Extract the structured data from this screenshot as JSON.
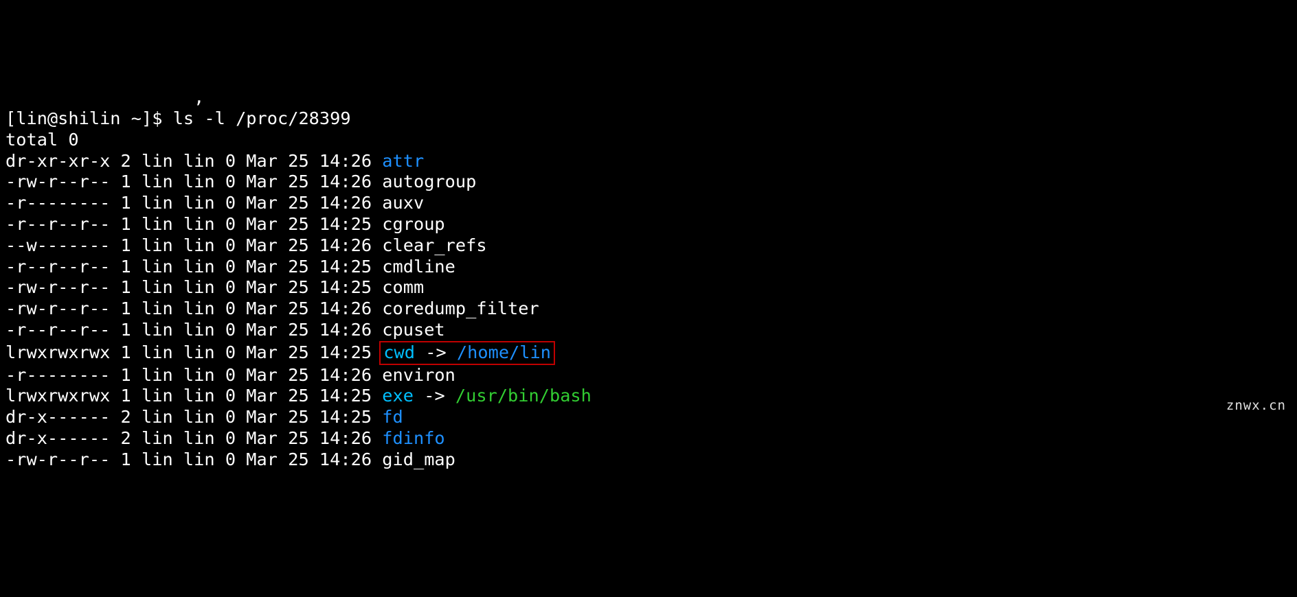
{
  "topfrag": {
    "tail": "                  ,"
  },
  "prompt": {
    "left": "[lin@shilin ~]$ ",
    "cmd": "ls -l /proc/28399"
  },
  "total": "total 0",
  "rows": [
    {
      "perm": "dr-xr-xr-x 2 lin lin 0 Mar 25 14:26 ",
      "name": "attr",
      "nameClass": "blue"
    },
    {
      "perm": "-rw-r--r-- 1 lin lin 0 Mar 25 14:26 ",
      "name": "autogroup",
      "nameClass": "white"
    },
    {
      "perm": "-r-------- 1 lin lin 0 Mar 25 14:26 ",
      "name": "auxv",
      "nameClass": "white"
    },
    {
      "perm": "-r--r--r-- 1 lin lin 0 Mar 25 14:25 ",
      "name": "cgroup",
      "nameClass": "white"
    },
    {
      "perm": "--w------- 1 lin lin 0 Mar 25 14:26 ",
      "name": "clear_refs",
      "nameClass": "white"
    },
    {
      "perm": "-r--r--r-- 1 lin lin 0 Mar 25 14:25 ",
      "name": "cmdline",
      "nameClass": "white"
    },
    {
      "perm": "-rw-r--r-- 1 lin lin 0 Mar 25 14:25 ",
      "name": "comm",
      "nameClass": "white"
    },
    {
      "perm": "-rw-r--r-- 1 lin lin 0 Mar 25 14:26 ",
      "name": "coredump_filter",
      "nameClass": "white"
    },
    {
      "perm": "-r--r--r-- 1 lin lin 0 Mar 25 14:26 ",
      "name": "cpuset",
      "nameClass": "white"
    },
    {
      "perm": "lrwxrwxrwx 1 lin lin 0 Mar 25 14:25 ",
      "name": "cwd",
      "nameClass": "cyan",
      "arrow": " -> ",
      "tgt": "/home/lin",
      "tgtClass": "blue",
      "boxed": true
    },
    {
      "perm": "-r-------- 1 lin lin 0 Mar 25 14:26 ",
      "name": "environ",
      "nameClass": "white"
    },
    {
      "perm": "lrwxrwxrwx 1 lin lin 0 Mar 25 14:25 ",
      "name": "exe",
      "nameClass": "cyan",
      "arrow": " -> ",
      "tgt": "/usr/bin/bash",
      "tgtClass": "green"
    },
    {
      "perm": "dr-x------ 2 lin lin 0 Mar 25 14:25 ",
      "name": "fd",
      "nameClass": "blue"
    },
    {
      "perm": "dr-x------ 2 lin lin 0 Mar 25 14:26 ",
      "name": "fdinfo",
      "nameClass": "blue"
    },
    {
      "perm": "-rw-r--r-- 1 lin lin 0 Mar 25 14:26 ",
      "name": "gid_map",
      "nameClass": "white"
    }
  ],
  "watermark": "znwx.cn"
}
